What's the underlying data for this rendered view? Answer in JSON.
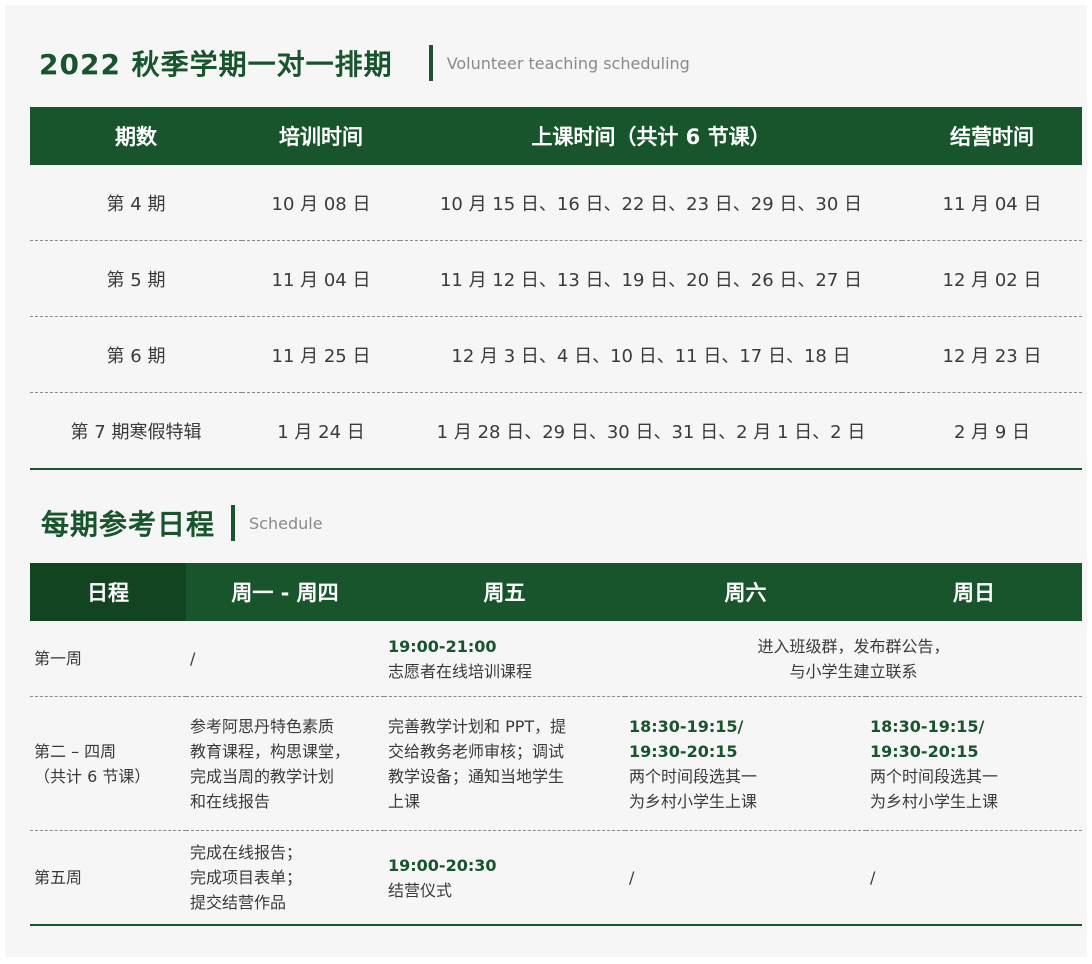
{
  "section1": {
    "title": "2022 秋季学期一对一排期",
    "subtitle": "Volunteer teaching scheduling",
    "headers": [
      "期数",
      "培训时间",
      "上课时间（共计 6 节课）",
      "结营时间"
    ],
    "rows": [
      [
        "第 4 期",
        "10 月 08 日",
        "10 月 15 日、16 日、22 日、23 日、29 日、30 日",
        "11 月 04 日"
      ],
      [
        "第 5 期",
        "11 月 04 日",
        "11 月 12 日、13 日、19 日、20 日、26 日、27 日",
        "12 月 02 日"
      ],
      [
        "第 6 期",
        "11 月 25 日",
        "12 月 3 日、4 日、10 日、11 日、17 日、18 日",
        "12 月 23 日"
      ],
      [
        "第 7 期寒假特辑",
        "1 月 24 日",
        "1 月 28 日、29 日、30 日、31 日、2 月 1 日、2 日",
        "2 月 9 日"
      ]
    ]
  },
  "section2": {
    "title": "每期参考日程",
    "subtitle": "Schedule",
    "headers": [
      "日程",
      "周一 - 周四",
      "周五",
      "周六",
      "周日"
    ],
    "week1": {
      "label": "第一周",
      "mon_thu": "/",
      "fri_time": "19:00-21:00",
      "fri_text": "志愿者在线培训课程",
      "weekend_line1": "进入班级群，发布群公告，",
      "weekend_line2": "与小学生建立联系"
    },
    "week2": {
      "label_line1": "第二 – 四周",
      "label_line2": "（共计 6 节课）",
      "mon_thu": [
        "参考阿思丹特色素质",
        "教育课程，构思课堂，",
        "完成当周的教学计划",
        "和在线报告"
      ],
      "fri": [
        "完善教学计划和 PPT，提",
        "交给教务老师审核；调试",
        "教学设备；通知当地学生",
        "上课"
      ],
      "sat_time1": "18:30-19:15/",
      "sat_time2": "19:30-20:15",
      "sat_text": [
        "两个时间段选其一",
        "为乡村小学生上课"
      ],
      "sun_time1": "18:30-19:15/",
      "sun_time2": "19:30-20:15",
      "sun_text": [
        "两个时间段选其一",
        "为乡村小学生上课"
      ]
    },
    "week5": {
      "label": "第五周",
      "mon_thu": [
        "完成在线报告；",
        "完成项目表单；",
        "提交结营作品"
      ],
      "fri_time": "19:00-20:30",
      "fri_text": "结营仪式",
      "sat": "/",
      "sun": "/"
    }
  },
  "colors": {
    "accent": "#18552d",
    "background": "#f6f6f6"
  }
}
